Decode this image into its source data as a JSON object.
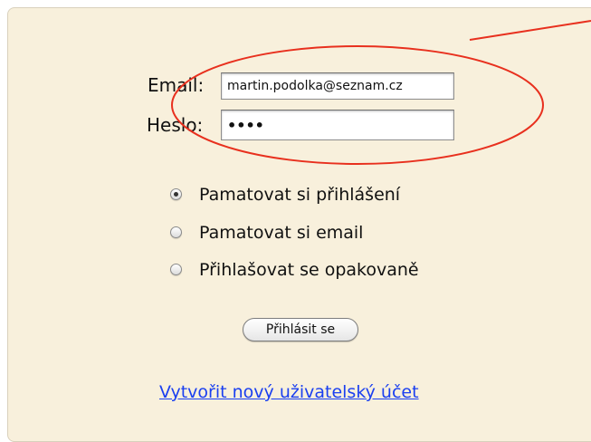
{
  "form": {
    "email_label": "Email:",
    "email_value": "martin.podolka@seznam.cz",
    "password_label": "Heslo:",
    "password_value": "••••"
  },
  "options": {
    "selected_index": 0,
    "items": [
      {
        "label": "Pamatovat si přihlášení",
        "checked": true
      },
      {
        "label": "Pamatovat si email",
        "checked": false
      },
      {
        "label": "Přihlašovat se opakovaně",
        "checked": false
      }
    ]
  },
  "actions": {
    "login_button": "Přihlásit se",
    "create_account_link": "Vytvořit nový uživatelský účet"
  },
  "colors": {
    "panel_background": "#f8f0dc",
    "annotation": "#e8301e",
    "link": "#1a3ff0"
  }
}
